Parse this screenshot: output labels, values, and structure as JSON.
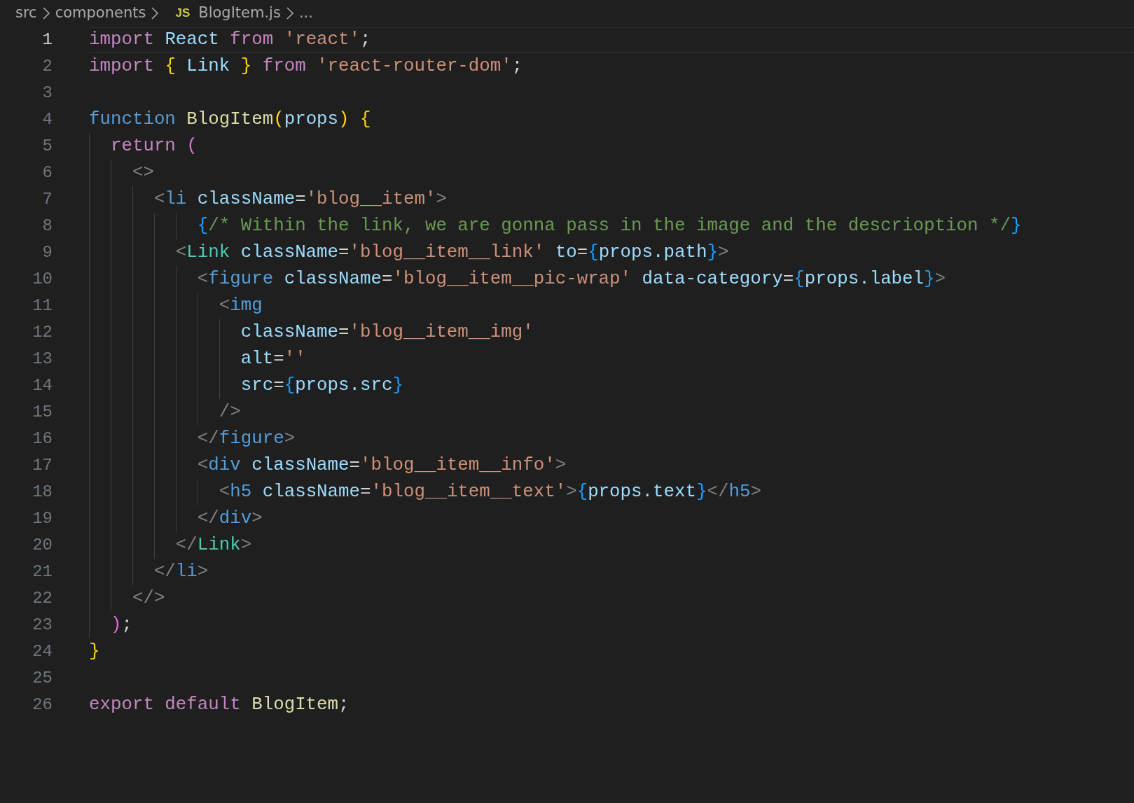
{
  "breadcrumbs": [
    {
      "label": "src"
    },
    {
      "label": "components"
    },
    {
      "label": "BlogItem.js",
      "badge": "JS"
    },
    {
      "label": "..."
    }
  ],
  "lines": [
    {
      "number": "1",
      "current": true,
      "tokens": [
        {
          "kind": "kw",
          "text": "import "
        },
        {
          "kind": "var",
          "text": "React "
        },
        {
          "kind": "kw",
          "text": "from "
        },
        {
          "kind": "str",
          "text": "'react'"
        },
        {
          "kind": "plain",
          "text": ";"
        }
      ]
    },
    {
      "number": "2",
      "current": false,
      "tokens": [
        {
          "kind": "kw",
          "text": "import "
        },
        {
          "kind": "b1",
          "text": "{ "
        },
        {
          "kind": "var",
          "text": "Link "
        },
        {
          "kind": "b1",
          "text": "} "
        },
        {
          "kind": "kw",
          "text": "from "
        },
        {
          "kind": "str",
          "text": "'react-router-dom'"
        },
        {
          "kind": "plain",
          "text": ";"
        }
      ]
    },
    {
      "number": "3",
      "current": false
    },
    {
      "number": "4",
      "current": false,
      "tokens": [
        {
          "kind": "storage",
          "text": "function "
        },
        {
          "kind": "fn",
          "text": "BlogItem"
        },
        {
          "kind": "b1",
          "text": "("
        },
        {
          "kind": "var",
          "text": "props"
        },
        {
          "kind": "b1",
          "text": ") {"
        }
      ]
    },
    {
      "number": "5",
      "current": false,
      "tokens": [
        {
          "kind": "kw",
          "text": "  return "
        },
        {
          "kind": "b2",
          "text": "("
        }
      ]
    },
    {
      "number": "6",
      "current": false,
      "tokens": [
        {
          "kind": "tagp",
          "text": "    <>"
        }
      ]
    },
    {
      "number": "7",
      "current": false,
      "tokens": [
        {
          "kind": "tagp",
          "text": "      <"
        },
        {
          "kind": "tag",
          "text": "li "
        },
        {
          "kind": "attr",
          "text": "className"
        },
        {
          "kind": "plain",
          "text": "="
        },
        {
          "kind": "str",
          "text": "'blog__item'"
        },
        {
          "kind": "tagp",
          "text": ">"
        }
      ]
    },
    {
      "number": "8",
      "current": false,
      "tokens": [
        {
          "kind": "b3",
          "text": "          {"
        },
        {
          "kind": "cmt",
          "text": "/* Within the link, we are gonna pass in the image and the descrioption */"
        },
        {
          "kind": "b3",
          "text": "}"
        }
      ]
    },
    {
      "number": "9",
      "current": false,
      "tokens": [
        {
          "kind": "tagp",
          "text": "        <"
        },
        {
          "kind": "comp",
          "text": "Link "
        },
        {
          "kind": "attr",
          "text": "className"
        },
        {
          "kind": "plain",
          "text": "="
        },
        {
          "kind": "str",
          "text": "'blog__item__link' "
        },
        {
          "kind": "attr",
          "text": "to"
        },
        {
          "kind": "plain",
          "text": "="
        },
        {
          "kind": "b3",
          "text": "{"
        },
        {
          "kind": "var",
          "text": "props.path"
        },
        {
          "kind": "b3",
          "text": "}"
        },
        {
          "kind": "tagp",
          "text": ">"
        }
      ]
    },
    {
      "number": "10",
      "current": false,
      "tokens": [
        {
          "kind": "tagp",
          "text": "          <"
        },
        {
          "kind": "tag",
          "text": "figure "
        },
        {
          "kind": "attr",
          "text": "className"
        },
        {
          "kind": "plain",
          "text": "="
        },
        {
          "kind": "str",
          "text": "'blog__item__pic-wrap' "
        },
        {
          "kind": "attr",
          "text": "data-category"
        },
        {
          "kind": "plain",
          "text": "="
        },
        {
          "kind": "b3",
          "text": "{"
        },
        {
          "kind": "var",
          "text": "props.label"
        },
        {
          "kind": "b3",
          "text": "}"
        },
        {
          "kind": "tagp",
          "text": ">"
        }
      ]
    },
    {
      "number": "11",
      "current": false,
      "tokens": [
        {
          "kind": "tagp",
          "text": "            <"
        },
        {
          "kind": "tag",
          "text": "img"
        }
      ]
    },
    {
      "number": "12",
      "current": false,
      "tokens": [
        {
          "kind": "attr",
          "text": "              className"
        },
        {
          "kind": "plain",
          "text": "="
        },
        {
          "kind": "str",
          "text": "'blog__item__img'"
        }
      ]
    },
    {
      "number": "13",
      "current": false,
      "tokens": [
        {
          "kind": "attr",
          "text": "              alt"
        },
        {
          "kind": "plain",
          "text": "="
        },
        {
          "kind": "str",
          "text": "''"
        }
      ]
    },
    {
      "number": "14",
      "current": false,
      "tokens": [
        {
          "kind": "attr",
          "text": "              src"
        },
        {
          "kind": "plain",
          "text": "="
        },
        {
          "kind": "b3",
          "text": "{"
        },
        {
          "kind": "var",
          "text": "props.src"
        },
        {
          "kind": "b3",
          "text": "}"
        }
      ]
    },
    {
      "number": "15",
      "current": false,
      "tokens": [
        {
          "kind": "tagp",
          "text": "            />"
        }
      ]
    },
    {
      "number": "16",
      "current": false,
      "tokens": [
        {
          "kind": "tagp",
          "text": "          </"
        },
        {
          "kind": "tag",
          "text": "figure"
        },
        {
          "kind": "tagp",
          "text": ">"
        }
      ]
    },
    {
      "number": "17",
      "current": false,
      "tokens": [
        {
          "kind": "tagp",
          "text": "          <"
        },
        {
          "kind": "tag",
          "text": "div "
        },
        {
          "kind": "attr",
          "text": "className"
        },
        {
          "kind": "plain",
          "text": "="
        },
        {
          "kind": "str",
          "text": "'blog__item__info'"
        },
        {
          "kind": "tagp",
          "text": ">"
        }
      ]
    },
    {
      "number": "18",
      "current": false,
      "tokens": [
        {
          "kind": "tagp",
          "text": "            <"
        },
        {
          "kind": "tag",
          "text": "h5 "
        },
        {
          "kind": "attr",
          "text": "className"
        },
        {
          "kind": "plain",
          "text": "="
        },
        {
          "kind": "str",
          "text": "'blog__item__text'"
        },
        {
          "kind": "tagp",
          "text": ">"
        },
        {
          "kind": "b3",
          "text": "{"
        },
        {
          "kind": "var",
          "text": "props.text"
        },
        {
          "kind": "b3",
          "text": "}"
        },
        {
          "kind": "tagp",
          "text": "</"
        },
        {
          "kind": "tag",
          "text": "h5"
        },
        {
          "kind": "tagp",
          "text": ">"
        }
      ]
    },
    {
      "number": "19",
      "current": false,
      "tokens": [
        {
          "kind": "tagp",
          "text": "          </"
        },
        {
          "kind": "tag",
          "text": "div"
        },
        {
          "kind": "tagp",
          "text": ">"
        }
      ]
    },
    {
      "number": "20",
      "current": false,
      "tokens": [
        {
          "kind": "tagp",
          "text": "        </"
        },
        {
          "kind": "comp",
          "text": "Link"
        },
        {
          "kind": "tagp",
          "text": ">"
        }
      ]
    },
    {
      "number": "21",
      "current": false,
      "tokens": [
        {
          "kind": "tagp",
          "text": "      </"
        },
        {
          "kind": "tag",
          "text": "li"
        },
        {
          "kind": "tagp",
          "text": ">"
        }
      ]
    },
    {
      "number": "22",
      "current": false,
      "tokens": [
        {
          "kind": "tagp",
          "text": "    </>"
        }
      ]
    },
    {
      "number": "23",
      "current": false,
      "tokens": [
        {
          "kind": "b2",
          "text": "  )"
        },
        {
          "kind": "plain",
          "text": ";"
        }
      ]
    },
    {
      "number": "24",
      "current": false,
      "tokens": [
        {
          "kind": "b1",
          "text": "}"
        }
      ]
    },
    {
      "number": "25",
      "current": false
    },
    {
      "number": "26",
      "current": false,
      "tokens": [
        {
          "kind": "kw",
          "text": "export default "
        },
        {
          "kind": "fn",
          "text": "BlogItem"
        },
        {
          "kind": "plain",
          "text": ";"
        }
      ]
    }
  ]
}
